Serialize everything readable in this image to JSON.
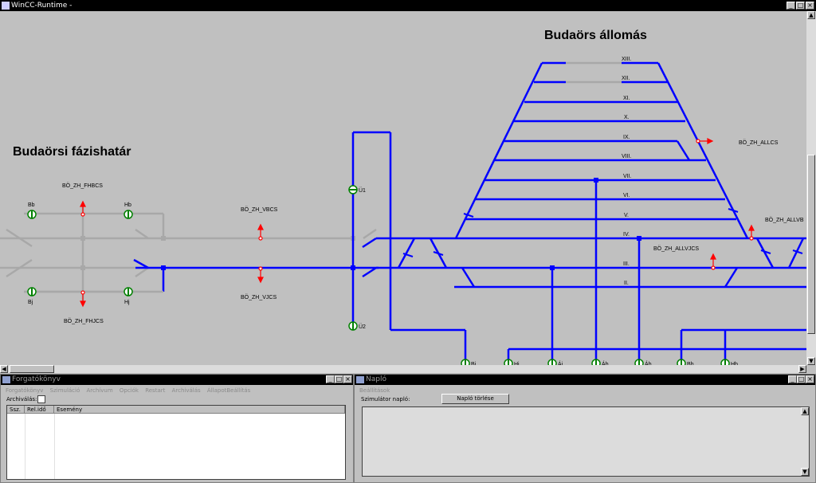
{
  "window": {
    "title": "WinCC-Runtime -"
  },
  "diagram": {
    "heading_station": "Budaörs állomás",
    "heading_border": "Budaörsi fázishatár",
    "track_labels": [
      "XIII.",
      "XII.",
      "XI.",
      "X.",
      "IX.",
      "VIII.",
      "VII.",
      "VI.",
      "V.",
      "IV.",
      "III.",
      "II."
    ],
    "signals": {
      "bb": "Bb",
      "hb": "Hb",
      "bj": "Bj",
      "hj": "Hj",
      "u1": "Ü1",
      "u2": "Ü2"
    },
    "sections": {
      "fhbcs": "BÖ_ZH_FHBCS",
      "vbcs": "BÖ_ZH_VBCS",
      "vjcs": "BÖ_ZH_VJCS",
      "fhjcs": "BÖ_ZH_FHJCS",
      "allcs": "BÖ_ZH_ALLCS",
      "allvb": "BÖ_ZH_ALLVB",
      "allvjcs": "BÖ_ZH_ALLVJCS"
    },
    "bottom_signals": [
      "Bj",
      "Hj",
      "Áj",
      "Áb",
      "Áb",
      "Bb",
      "Hb"
    ]
  },
  "colors": {
    "track_active": "#0000ff",
    "track_inactive": "#a8a8a8",
    "arrow": "#ff0000",
    "signal": "#00a000"
  },
  "left_panel": {
    "title": "Forgatókönyv",
    "menu": [
      "Forgatókönyv",
      "Szimuláció",
      "Archívum",
      "Opciók",
      "Restart",
      "Archiválás",
      "ÁllapotBeállítás"
    ],
    "archive_label": "Archiválás:",
    "columns": [
      "Ssz.",
      "Rel.idő",
      "Esemény"
    ]
  },
  "right_panel": {
    "title": "Napló",
    "menu": [
      "Beállítások"
    ],
    "sim_label": "Szimulátor napló:",
    "clear_button": "Napló törlése"
  }
}
